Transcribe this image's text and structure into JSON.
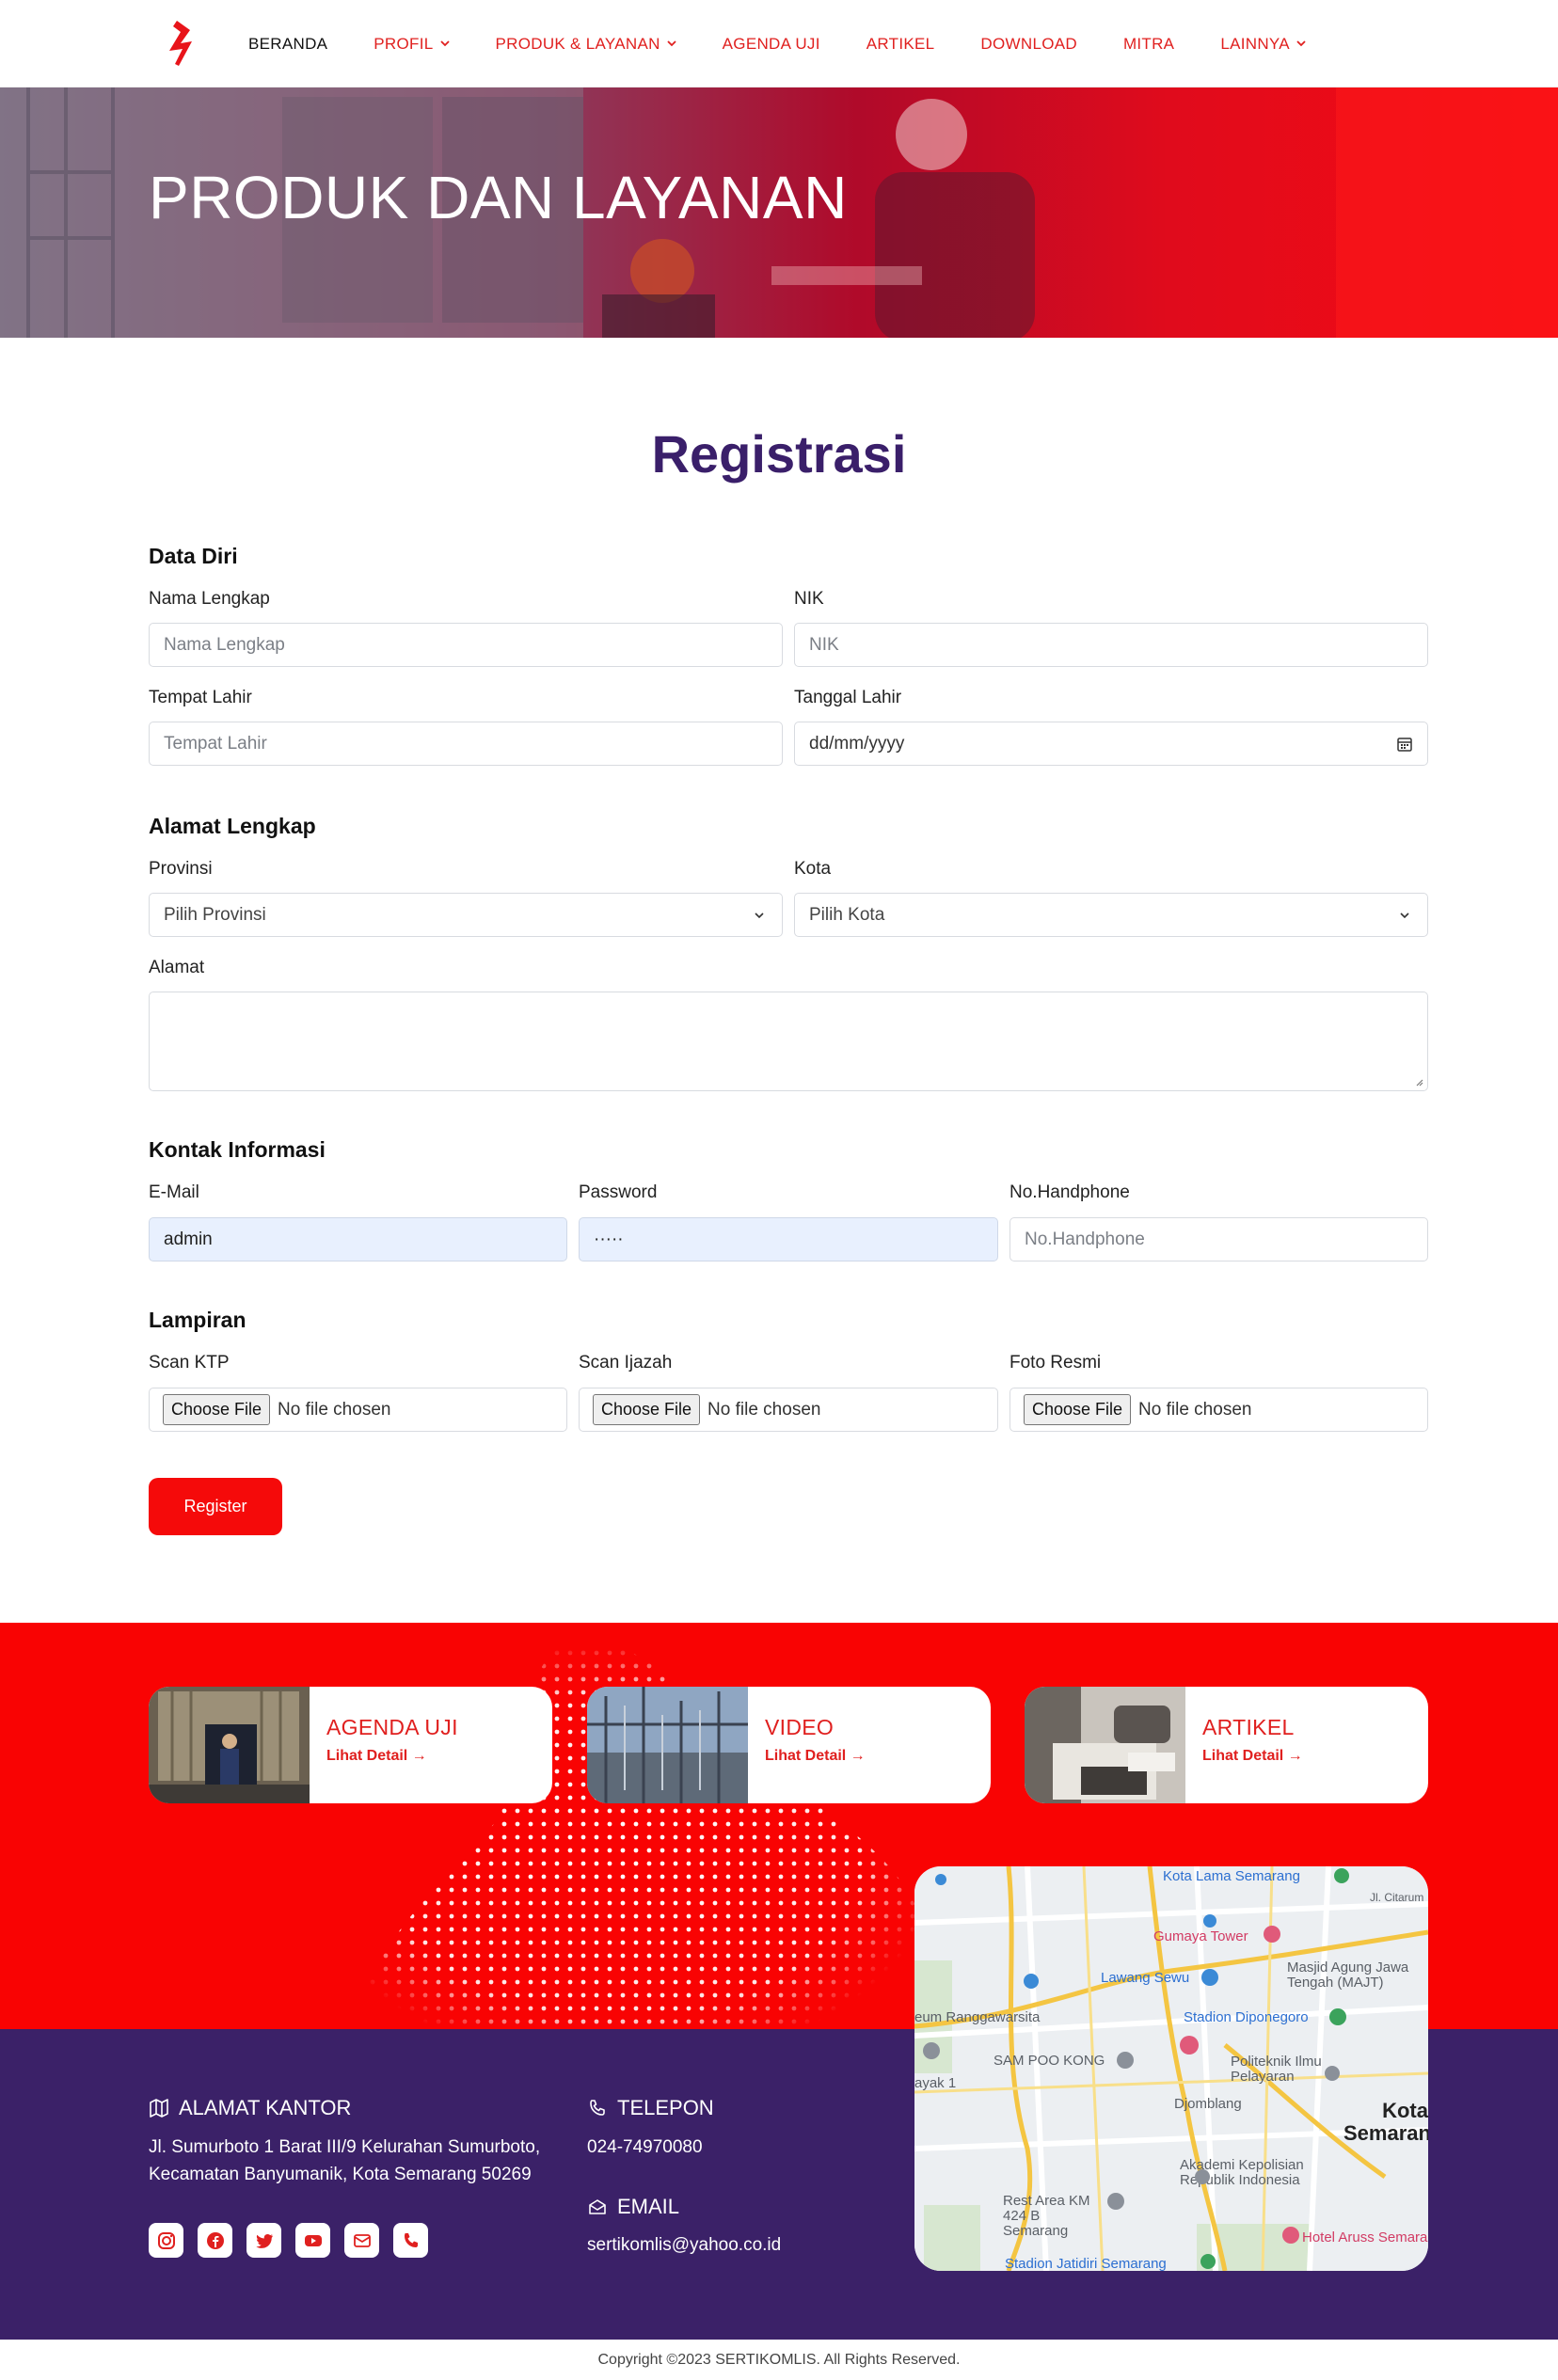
{
  "nav": {
    "items": [
      {
        "label": "BERANDA",
        "dropdown": false
      },
      {
        "label": "PROFIL",
        "dropdown": true
      },
      {
        "label": "PRODUK & LAYANAN",
        "dropdown": true
      },
      {
        "label": "AGENDA UJI",
        "dropdown": false
      },
      {
        "label": "ARTIKEL",
        "dropdown": false
      },
      {
        "label": "DOWNLOAD",
        "dropdown": false
      },
      {
        "label": "MITRA",
        "dropdown": false
      },
      {
        "label": "LAINNYA",
        "dropdown": true
      }
    ],
    "logo_icon": "lightning-bolt-icon"
  },
  "hero": {
    "title": "PRODUK DAN LAYANAN"
  },
  "form": {
    "title": "Registrasi",
    "data_diri": {
      "heading": "Data Diri",
      "nama_label": "Nama Lengkap",
      "nama_placeholder": "Nama Lengkap",
      "nik_label": "NIK",
      "nik_placeholder": "NIK",
      "tempat_label": "Tempat Lahir",
      "tempat_placeholder": "Tempat Lahir",
      "tanggal_label": "Tanggal Lahir",
      "tanggal_value": "dd/mm/yyyy"
    },
    "alamat": {
      "heading": "Alamat Lengkap",
      "provinsi_label": "Provinsi",
      "provinsi_value": "Pilih Provinsi",
      "kota_label": "Kota",
      "kota_value": "Pilih Kota",
      "alamat_label": "Alamat"
    },
    "kontak": {
      "heading": "Kontak Informasi",
      "email_label": "E-Mail",
      "email_value": "admin",
      "password_label": "Password",
      "password_value": "·····",
      "hp_label": "No.Handphone",
      "hp_placeholder": "No.Handphone"
    },
    "lampiran": {
      "heading": "Lampiran",
      "files": [
        {
          "label": "Scan KTP",
          "button": "Choose File",
          "status": "No file chosen"
        },
        {
          "label": "Scan Ijazah",
          "button": "Choose File",
          "status": "No file chosen"
        },
        {
          "label": "Foto Resmi",
          "button": "Choose File",
          "status": "No file chosen"
        }
      ]
    },
    "register_label": "Register"
  },
  "cards": [
    {
      "title": "AGENDA UJI",
      "link": "Lihat Detail →"
    },
    {
      "title": "VIDEO",
      "link": "Lihat Detail →"
    },
    {
      "title": "ARTIKEL",
      "link": "Lihat Detail →"
    }
  ],
  "footer": {
    "alamat_heading": "ALAMAT KANTOR",
    "alamat_line1": "Jl. Sumurboto 1 Barat III/9 Kelurahan Sumurboto,",
    "alamat_line2": "Kecamatan Banyumanik, Kota Semarang 50269",
    "telepon_heading": "TELEPON",
    "telepon_value": "024-74970080",
    "email_heading": "EMAIL",
    "email_value": "sertikomlis@yahoo.co.id",
    "social_icons": [
      "instagram-icon",
      "facebook-icon",
      "twitter-icon",
      "youtube-icon",
      "mail-icon",
      "phone-icon"
    ],
    "copyright": "Copyright ©2023 SERTIKOMLIS. All Rights Reserved."
  },
  "map": {
    "labels": [
      "Kota Lama Semarang",
      "Jl. Citarum",
      "Gumaya Tower",
      "Masjid Agung Jawa Tengah (MAJT)",
      "Lawang Sewu",
      "eum Ranggawarsita",
      "Stadion Diponegoro",
      "SAM POO KONG",
      "Politeknik Ilmu Pelayaran",
      "Djomblang",
      "Kota Semarang",
      "Akademi Kepolisian Republik Indonesia",
      "Rest Area KM 424 B Semarang",
      "Hotel Aruss Semarang",
      "Stadion Jatidiri Semarang",
      "ayak 1"
    ]
  },
  "colors": {
    "brand_red": "#f50a0a",
    "nav_red": "#e0201f",
    "title_purple": "#3a1f6a",
    "footer_purple": "#3b2168"
  }
}
